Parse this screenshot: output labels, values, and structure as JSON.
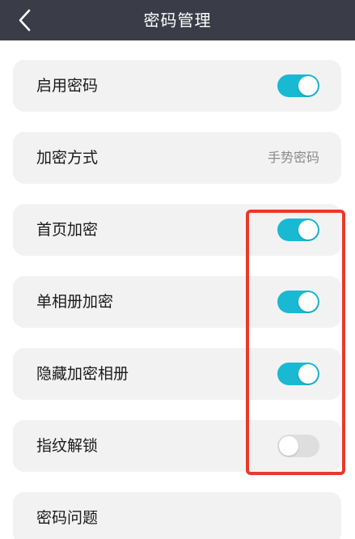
{
  "nav": {
    "title": "密码管理",
    "back_icon": "chevron-left-icon",
    "background": "#3a3d47"
  },
  "rows": [
    {
      "label": "启用密码",
      "control": "toggle",
      "on": true
    },
    {
      "label": "加密方式",
      "control": "value",
      "value": "手势密码"
    },
    {
      "label": "首页加密",
      "control": "toggle",
      "on": true
    },
    {
      "label": "单相册加密",
      "control": "toggle",
      "on": true
    },
    {
      "label": "隐藏加密相册",
      "control": "toggle",
      "on": true
    },
    {
      "label": "指纹解锁",
      "control": "toggle",
      "on": false
    },
    {
      "label": "密码问题",
      "control": "none"
    }
  ],
  "colors": {
    "toggle_on": "#19b9d3",
    "toggle_off": "#dedede",
    "highlight": "#e8392b",
    "row_background": "#f2f2f2"
  }
}
